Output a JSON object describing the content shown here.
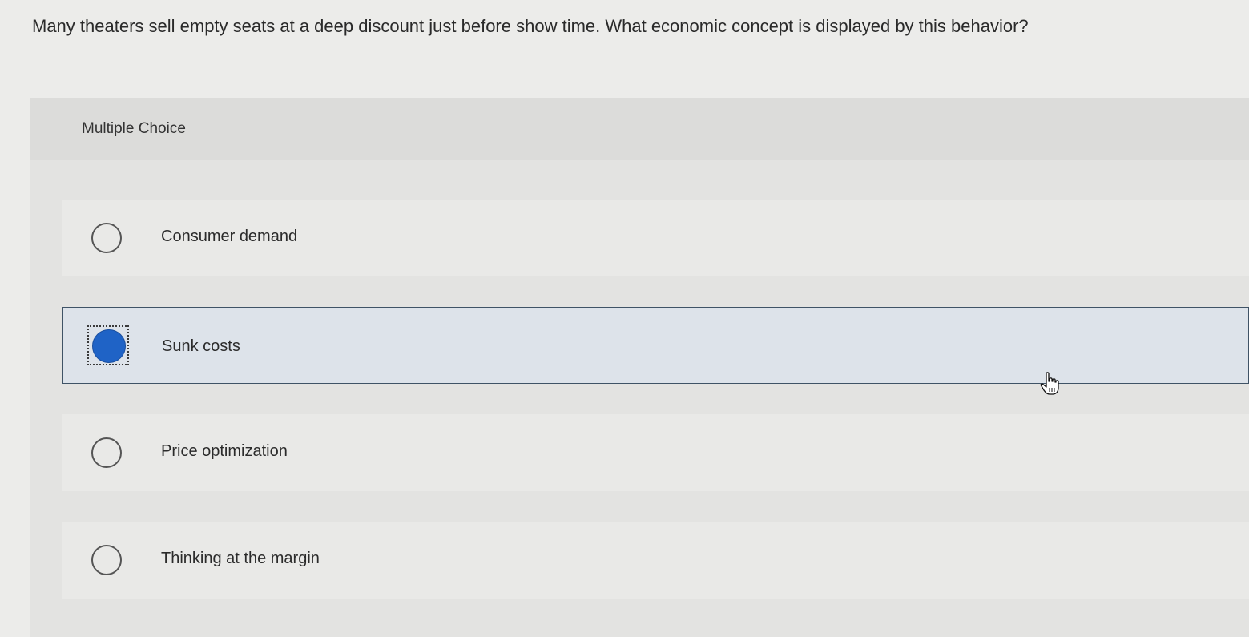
{
  "question": {
    "text": "Many theaters sell empty seats at a deep discount just before show time. What economic concept is displayed by this behavior?"
  },
  "panel": {
    "label": "Multiple Choice"
  },
  "options": [
    {
      "label": "Consumer demand",
      "selected": false
    },
    {
      "label": "Sunk costs",
      "selected": true
    },
    {
      "label": "Price optimization",
      "selected": false
    },
    {
      "label": "Thinking at the margin",
      "selected": false
    }
  ],
  "colors": {
    "selected_radio": "#1f63c6",
    "selected_border": "#3f5366"
  },
  "cursor": {
    "icon": "hand-pointer-icon"
  }
}
